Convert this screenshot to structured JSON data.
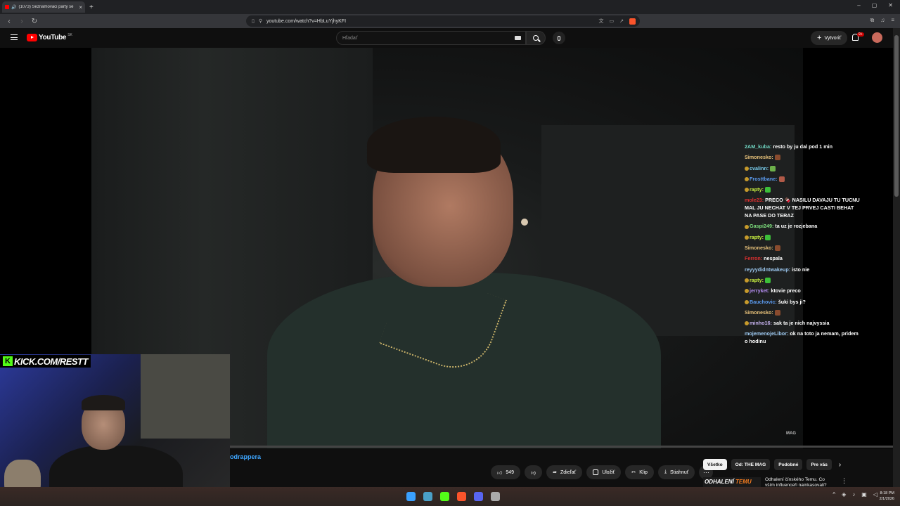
{
  "browser": {
    "tab_title": "(1073) Seznamovaci party se",
    "tab_close": "×",
    "new_tab": "+",
    "url": "youtube.com/watch?v=HbLuYjhyKFI",
    "window_controls": [
      "–",
      "▢",
      "✕"
    ]
  },
  "youtube": {
    "logo_text": "YouTube",
    "country": "SK",
    "search_placeholder": "Hľadať",
    "create_label": "Vytvoriť",
    "notif_count": "9+"
  },
  "video": {
    "watermark": "MAG",
    "title_fragment": "odrappera"
  },
  "overlay": {
    "kick_label": "KICK.COM/RESTT"
  },
  "chat": {
    "messages": [
      {
        "user": "2AM_kuba:",
        "text": "resto by ju dal pod 1 min",
        "color": "#6fd3c0",
        "badge": false
      },
      {
        "user": "Simonesko:",
        "text": "",
        "color": "#e8c27a",
        "badge": false,
        "emote": "#8a4b2e"
      },
      {
        "user": "cvalinn:",
        "text": "",
        "color": "#7ad0f0",
        "badge": true,
        "emote": "#6db04a"
      },
      {
        "user": "Frosttbane:",
        "text": "",
        "color": "#5b9bf0",
        "badge": true,
        "emote": "#b15a48"
      },
      {
        "user": "rapty:",
        "text": "",
        "color": "#c8f040",
        "badge": true,
        "emote": "#3cbf3a"
      },
      {
        "user": "mole23:",
        "text": "PRECO 🍫 NASILU DAVAJU TU TUCNU MAL JU NECHAT V TEJ PRVEJ CASTI BEHAT NA PASE DO TERAZ",
        "color": "#e03030",
        "badge": false,
        "wrap": true
      },
      {
        "user": "Gaspi249:",
        "text": "ta uz je rozjebana",
        "color": "#7ee07e",
        "badge": true
      },
      {
        "user": "rapty:",
        "text": "",
        "color": "#c8f040",
        "badge": true,
        "emote": "#3cbf3a"
      },
      {
        "user": "Simonesko:",
        "text": "",
        "color": "#e8c27a",
        "badge": false,
        "emote": "#8a4b2e"
      },
      {
        "user": "Ferron:",
        "text": "nespala",
        "color": "#e03030",
        "badge": false
      },
      {
        "user": "reyyydidntwakeup:",
        "text": "isto nie",
        "color": "#9cc8f0",
        "badge": false
      },
      {
        "user": "rapty:",
        "text": "",
        "color": "#c8f040",
        "badge": true,
        "emote": "#3cbf3a"
      },
      {
        "user": "jerryket:",
        "text": "ktovie preco",
        "color": "#b48cf0",
        "badge": true
      },
      {
        "user": "Bauchovic:",
        "text": "šuki bys ji?",
        "color": "#5b9bf0",
        "badge": true
      },
      {
        "user": "Simonesko:",
        "text": "",
        "color": "#e8c27a",
        "badge": false,
        "emote": "#8a4b2e"
      },
      {
        "user": "minho16:",
        "text": "sak ta je nich najvyssia",
        "color": "#c8b4f0",
        "badge": true
      },
      {
        "user": "mojemenojeLibor:",
        "text": "ok na toto ja nemam, pridem o hodinu",
        "color": "#9cc8f0",
        "badge": false,
        "wrap": true
      }
    ]
  },
  "actions": {
    "like_count": "949",
    "share_label": "Zdieľať",
    "save_label": "Uložiť",
    "clip_label": "Klip",
    "download_label": "Stiahnuť",
    "more_label": "···"
  },
  "chips": [
    "Všetko",
    "Od: THE MAG",
    "Podobné",
    "Pre vás"
  ],
  "chip_next": "›",
  "recommendation": {
    "thumb_text_a": "ODHALENÍ",
    "thumb_text_b": "TEMU",
    "title": "Odhalení čínského Temu. Co vším influenceři nainkasovali?",
    "more": "⋮"
  },
  "taskbar": {
    "time": "8:18 PM",
    "date": "2/1/2026",
    "apps": [
      "#3aa0ff",
      "#4aa0c8",
      "#53fc18",
      "#fb542b",
      "#5865f2",
      "#aaaaaa"
    ]
  }
}
